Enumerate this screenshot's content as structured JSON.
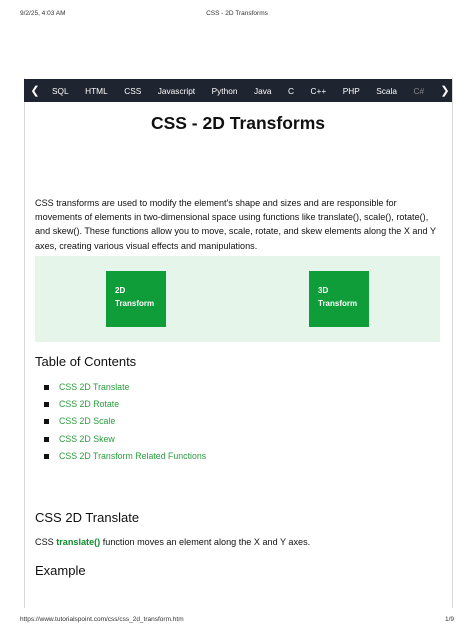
{
  "print_header": {
    "date": "9/2/25, 4:03 AM",
    "title": "CSS - 2D Transforms"
  },
  "navbar": {
    "items": [
      "SQL",
      "HTML",
      "CSS",
      "Javascript",
      "Python",
      "Java",
      "C",
      "C++",
      "PHP",
      "Scala",
      "C#"
    ],
    "left_arrow_icon": "chevron-left-icon",
    "right_arrow_icon": "chevron-right-icon"
  },
  "article": {
    "title": "CSS - 2D Transforms",
    "intro": "CSS transforms are used to modify the element's shape and sizes and are responsible for movements of elements in two-dimensional space using functions like translate(), scale(), rotate(), and skew(). These functions allow you to move, scale, rotate, and skew elements along the X and Y axes, creating various visual effects and manipulations.",
    "demo": {
      "button_2d": [
        "2D",
        "Transform"
      ],
      "button_3d": [
        "3D",
        "Transform"
      ]
    },
    "toc": {
      "title": "Table of Contents",
      "items": [
        "CSS 2D Translate",
        "CSS 2D Rotate",
        "CSS 2D Scale",
        "CSS 2D Skew",
        "CSS 2D Transform Related Functions"
      ]
    },
    "section": {
      "title": "CSS 2D Translate",
      "text_before": "CSS ",
      "code": "translate()",
      "text_after": " function moves an element along the X and Y axes.",
      "example_heading": "Example"
    }
  },
  "print_footer": {
    "url": "https://www.tutorialspoint.com/css/css_2d_transform.htm",
    "pages": "1/9"
  }
}
